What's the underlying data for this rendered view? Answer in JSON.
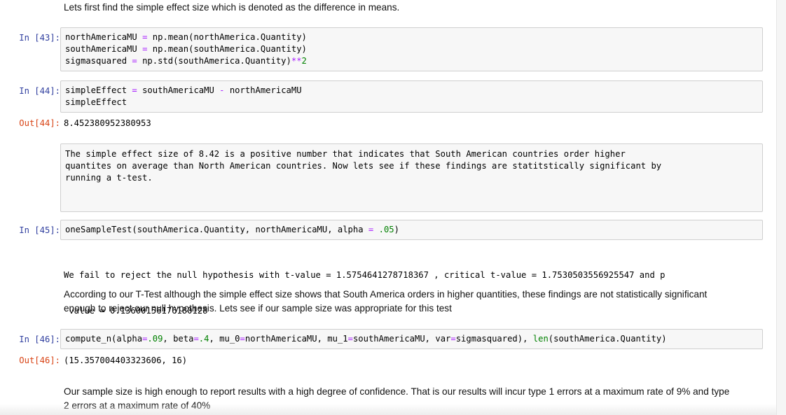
{
  "cells": {
    "md1": "Lets first find the simple effect size which is denoted as the difference in means.",
    "c43": {
      "prompt": "In [43]:",
      "lines": [
        [
          {
            "t": "northAmericaMU "
          },
          {
            "t": "=",
            "c": "op"
          },
          {
            "t": " np.mean(northAmerica.Quantity)"
          }
        ],
        [
          {
            "t": "southAmericaMU "
          },
          {
            "t": "=",
            "c": "op"
          },
          {
            "t": " np.mean(southAmerica.Quantity)"
          }
        ],
        [
          {
            "t": "sigmasquared "
          },
          {
            "t": "=",
            "c": "op"
          },
          {
            "t": " np.std(southAmerica.Quantity)"
          },
          {
            "t": "**",
            "c": "op"
          },
          {
            "t": "2",
            "c": "num"
          }
        ]
      ]
    },
    "c44": {
      "prompt": "In [44]:",
      "lines": [
        [
          {
            "t": "simpleEffect "
          },
          {
            "t": "=",
            "c": "op"
          },
          {
            "t": " southAmericaMU "
          },
          {
            "t": "-",
            "c": "op"
          },
          {
            "t": " northAmericaMU"
          }
        ],
        [
          {
            "t": "simpleEffect"
          }
        ]
      ],
      "out_prompt": "Out[44]:",
      "out_text": "8.452380952380953"
    },
    "raw": {
      "line1": "The simple effect size of 8.42 is a positive number that indicates that South American countries order higher",
      "line2": "quantites on average than North American countries. Now lets see if these findings are statitstically significant by",
      "line3": "running a t-test."
    },
    "c45": {
      "prompt": "In [45]:",
      "lines": [
        [
          {
            "t": "oneSampleTest(southAmerica.Quantity, northAmericaMU, alpha "
          },
          {
            "t": "=",
            "c": "op"
          },
          {
            "t": " "
          },
          {
            "t": ".05",
            "c": "num"
          },
          {
            "t": ")"
          }
        ]
      ],
      "stdout1": "We fail to reject the null hypothesis with t-value = 1.5754641278718367 , critical t-value = 1.7530503556925547 and p",
      "stdout2": "-value = 0.13600156176180128"
    },
    "md2": {
      "line1": "According to our T-Test although the simple effect size shows that South America orders in higher quantities, these findings are not statistically significant",
      "line2": "enough to reject our null hypothesis. Lets see if our sample size was appropriate for this test"
    },
    "c46": {
      "prompt": "In [46]:",
      "lines": [
        [
          {
            "t": "compute_n(alpha"
          },
          {
            "t": "=",
            "c": "op"
          },
          {
            "t": ".09",
            "c": "num"
          },
          {
            "t": ", beta"
          },
          {
            "t": "=",
            "c": "op"
          },
          {
            "t": ".4",
            "c": "num"
          },
          {
            "t": ", mu_0"
          },
          {
            "t": "=",
            "c": "op"
          },
          {
            "t": "northAmericaMU, mu_1"
          },
          {
            "t": "=",
            "c": "op"
          },
          {
            "t": "southAmericaMU, var"
          },
          {
            "t": "=",
            "c": "op"
          },
          {
            "t": "sigmasquared), "
          },
          {
            "t": "len",
            "c": "bi"
          },
          {
            "t": "(southAmerica.Quantity)"
          }
        ]
      ],
      "out_prompt": "Out[46]:",
      "out_text": "(15.357004403323606, 16)"
    },
    "md3": {
      "line1": "Our sample size is high enough to report results with a high degree of confidence. That is our results will incur type 1 errors at a maximum rate of 9% and type",
      "line2": "2 errors at a maximum rate of 40%"
    }
  },
  "colors": {
    "in_prompt": "#303f9f",
    "out_prompt": "#d84315",
    "operator": "#aa22ff",
    "number": "#008000",
    "cell_bg": "#f7f7f7"
  }
}
